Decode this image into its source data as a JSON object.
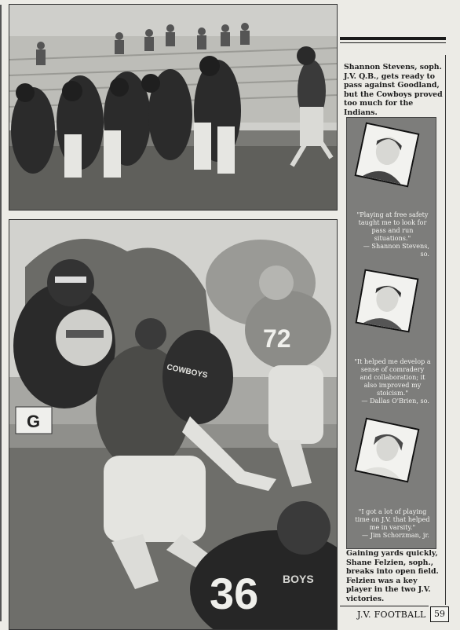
{
  "top_caption": "Shannon Stevens, soph. J.V. Q.B., gets ready to pass against Goodland, but the Cowboys proved too much for the Indians.",
  "bottom_caption": "Gaining yards quickly, Shane Felzien, soph., breaks into open field. Felzien was a key player in the two J.V. victories.",
  "quotes": [
    {
      "text": "\"Playing at free safety taught me to look for pass and run situations.\"",
      "attribution": "— Shannon Stevens, so."
    },
    {
      "text": "\"It helped me develop a sense of comradery and collaboration; it also improved my stoicism.\"",
      "attribution": "— Dallas O'Brien, so."
    },
    {
      "text": "\"I got a lot of playing time on J.V. that helped me in varsity.\"",
      "attribution": "— Jim Schorzman, jr."
    }
  ],
  "jersey_numbers": {
    "top_player": "72",
    "bottom_player": "36"
  },
  "jersey_text": "BOYS",
  "jersey_text_2": "COWBOYS",
  "field_sign": "G",
  "footer": {
    "section": "J.V. FOOTBALL",
    "page": "59"
  }
}
